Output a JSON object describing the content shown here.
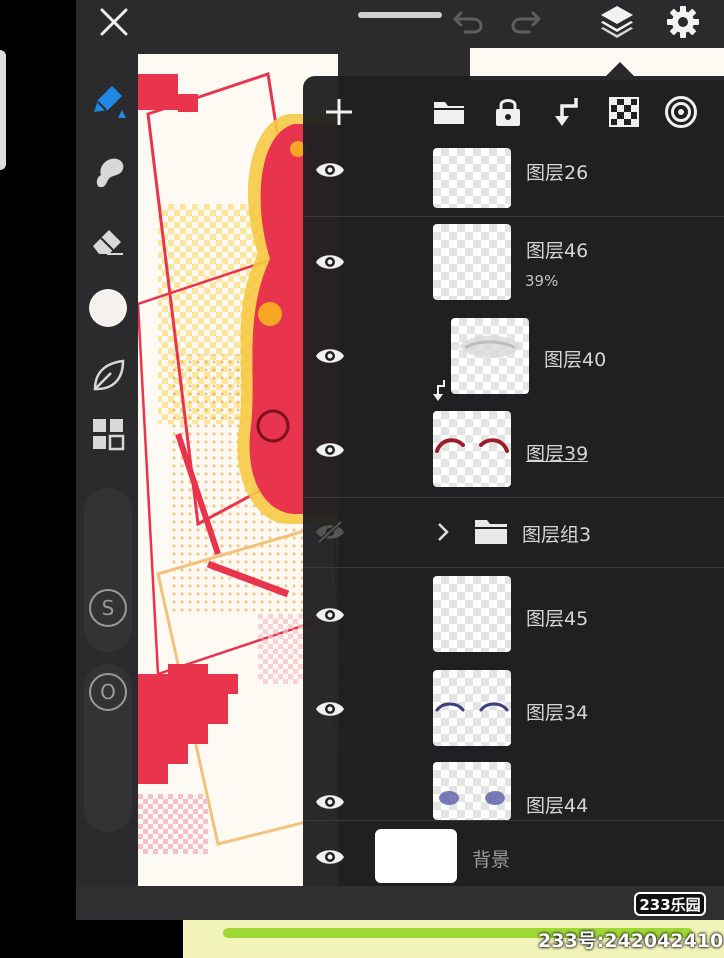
{
  "colors": {
    "chrome": "#2b2b2d",
    "panel": "#202022",
    "brush_accent": "#1e88e5",
    "text": "#d6d6d6",
    "canvas_red": "#e8344c",
    "canvas_yellow": "#f6c945"
  },
  "top_bar": {
    "icons": [
      "close-icon",
      "undo-icon",
      "redo-icon",
      "layers-icon",
      "gear-icon"
    ]
  },
  "toolbar": {
    "tools": [
      "brush-icon",
      "smudge-icon",
      "eraser-icon",
      "color-swatch",
      "leaf-icon",
      "grid-icon"
    ],
    "size_slider_label": "S",
    "opacity_slider_label": "O"
  },
  "layers_panel": {
    "actions": [
      "add-layer-icon",
      "folder-icon",
      "lock-icon",
      "clip-arrow-icon",
      "checker-icon",
      "target-icon"
    ],
    "layers": [
      {
        "name": "图层26",
        "visible": true
      },
      {
        "name": "图层46",
        "opacity": "39%",
        "visible": true
      },
      {
        "name": "图层40",
        "visible": true,
        "clipped": true
      },
      {
        "name": "图层39",
        "visible": true,
        "selected": true
      },
      {
        "name": "图层组3",
        "visible": false,
        "is_group": true,
        "collapsed": true
      },
      {
        "name": "图层45",
        "visible": true
      },
      {
        "name": "图层34",
        "visible": true
      },
      {
        "name": "图层44",
        "visible": true
      },
      {
        "name": "背景",
        "visible": true,
        "background": true
      }
    ]
  },
  "watermark": {
    "logo": "233乐园",
    "id_text": "233号:242042410"
  }
}
